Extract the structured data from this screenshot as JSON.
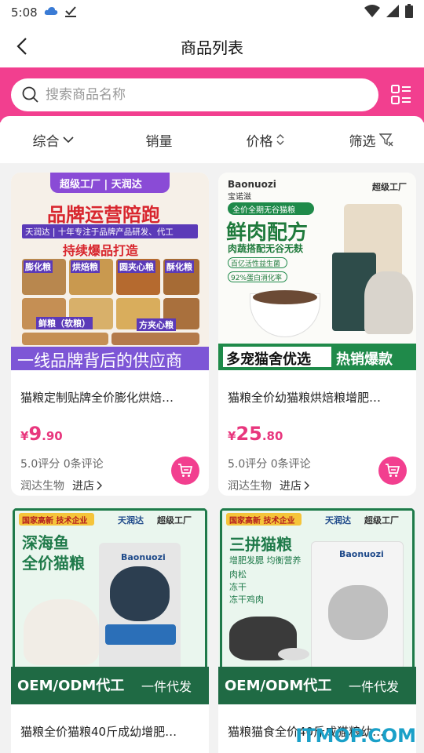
{
  "status_bar": {
    "time": "5:08"
  },
  "header": {
    "title": "商品列表"
  },
  "search": {
    "placeholder": "搜索商品名称"
  },
  "filters": [
    {
      "label": "综合"
    },
    {
      "label": "销量"
    },
    {
      "label": "价格"
    },
    {
      "label": "筛选"
    }
  ],
  "products": [
    {
      "title": "猫粮定制贴牌全价膨化烘焙…",
      "price_symbol": "¥",
      "price_int": "9",
      "price_dec": ".90",
      "rating": "5.0评分 0条评论",
      "shop": "润达生物",
      "shop_link": "进店",
      "image_text": {
        "banner": "超级工厂 | 天润达",
        "headline": "品牌运营陪跑",
        "sub": "天润达 | 十年专注于品牌产品研发、代工",
        "tagline": "持续爆品打造",
        "tag1": "膨化粮",
        "tag2": "烘焙粮",
        "tag3": "圆夹心粮",
        "tag4": "酥化粮",
        "tag5": "鲜粮（软粮）",
        "tag6": "方夹心粮",
        "footer": "一线品牌背后的供应商"
      }
    },
    {
      "title": "猫粮全价幼猫粮烘焙粮增肥…",
      "price_symbol": "¥",
      "price_int": "25",
      "price_dec": ".80",
      "rating": "5.0评分 0条评论",
      "shop": "润达生物",
      "shop_link": "进店",
      "image_text": {
        "brand": "Baonuozi",
        "brand_cn": "宝诺滋",
        "badge": "超级工厂",
        "pill": "全价全期无谷猫粮",
        "headline": "鲜肉配方",
        "sub": "肉蔬搭配无谷无麸",
        "b1": "百亿活性益生菌",
        "b2": "92%蛋白消化率",
        "footer_a": "多宠猫舍优选",
        "footer_b": "热销爆款"
      }
    },
    {
      "title": "猫粮全价猫粮40斤成幼增肥…",
      "image_text": {
        "tag": "国家高新 技术企业",
        "brand": "天润达",
        "badge": "超级工厂",
        "headline1": "深海鱼",
        "headline2": "全价猫粮",
        "bag_brand": "Baonuozi",
        "footer_a": "OEM/ODM代工",
        "footer_b": "一件代发"
      }
    },
    {
      "title": "猫粮猫食全价40斤成猫粮幼…",
      "image_text": {
        "tag": "国家高新 技术企业",
        "brand": "天润达",
        "badge": "超级工厂",
        "headline": "三拼猫粮",
        "sub": "增肥发腮 均衡营养",
        "b1": "肉松",
        "b2": "冻干",
        "b3": "冻干鸡肉",
        "bag_brand": "Baonuozi",
        "footer_a": "OEM/ODM代工",
        "footer_b": "一件代发"
      }
    }
  ],
  "watermark": "ITMOP.COM"
}
